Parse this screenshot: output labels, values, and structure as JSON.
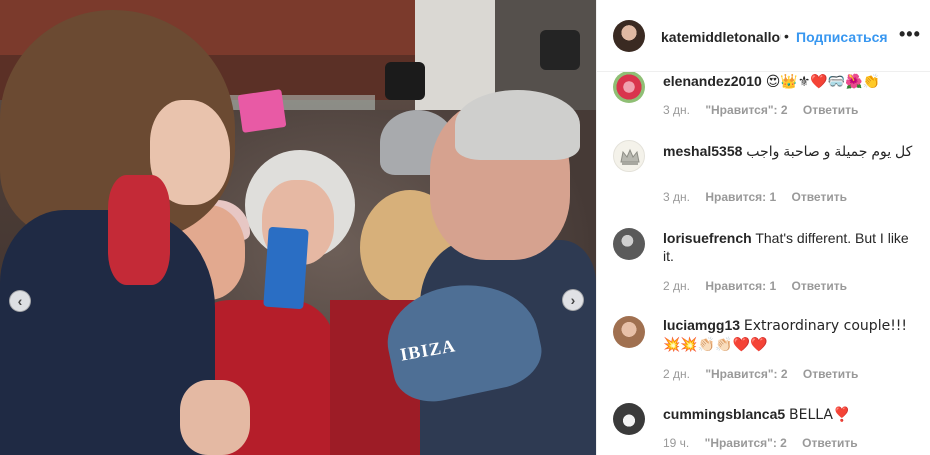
{
  "post": {
    "username": "katemiddletonallou",
    "separator": "•",
    "follow_label": "Подписаться",
    "more_label": "•••"
  },
  "photo": {
    "cap_text": "IBIZA",
    "prev_label": "‹",
    "next_label": "›"
  },
  "comments": [
    {
      "username": "elenandez2010",
      "text": "😍👑⚜❤️🥽🌺👏",
      "time": "3 дн.",
      "likes": "\"Нравится\": 2",
      "reply": "Ответить",
      "avatar_icon": "flower-avatar-icon",
      "avatar_color": "#d9344d"
    },
    {
      "username": "meshal5358",
      "text": "كل يوم جميلة و صاحبة واجب",
      "time": "3 дн.",
      "likes": "Нравится: 1",
      "reply": "Ответить",
      "avatar_icon": "crown-avatar-icon",
      "avatar_color": "#b8b8b0"
    },
    {
      "username": "lorisuefrench",
      "text": "That's different. But I like it.",
      "time": "2 дн.",
      "likes": "Нравится: 1",
      "reply": "Ответить",
      "avatar_icon": "profile-avatar-icon",
      "avatar_color": "#5a5a5a"
    },
    {
      "username": "luciamgg13",
      "text": "Extraordinary couple!!!💥💥👏🏻👏🏻❤️❤️",
      "time": "2 дн.",
      "likes": "\"Нравится\": 2",
      "reply": "Ответить",
      "avatar_icon": "profile-avatar-icon",
      "avatar_color": "#d9a58a"
    },
    {
      "username": "cummingsblanca5",
      "text": "BELLA❣️",
      "time": "19 ч.",
      "likes": "\"Нравится\": 2",
      "reply": "Ответить",
      "avatar_icon": "profile-avatar-icon",
      "avatar_color": "#3a3a3a"
    }
  ],
  "colors": {
    "link": "#3897f0",
    "text": "#262626",
    "muted": "#999999",
    "border": "#efefef"
  }
}
